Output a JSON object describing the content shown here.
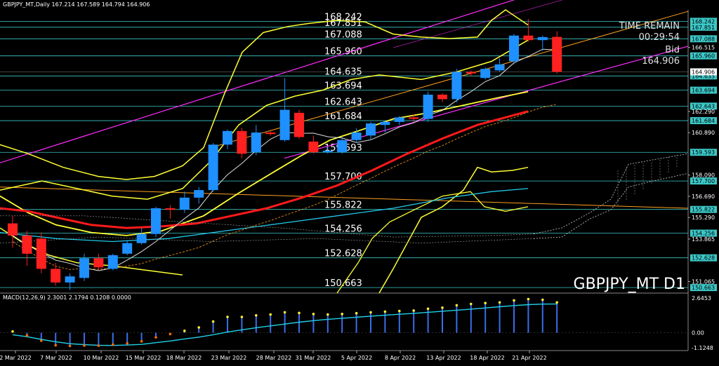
{
  "header": {
    "symbol_line": "GBPJPY_MT,Daily  167.214 167.589 164.794 164.906",
    "macd_line": "MACD(12,26,9) 2.3001 2.1794 0.1208 0.0000"
  },
  "info": {
    "time_remain_label": "TIME REMAIN",
    "time_remain_value": "00:29:54",
    "bid_label": "Bid",
    "bid_value": "164.906",
    "symbol_watermark": "GBPJPY_MT D1"
  },
  "colors": {
    "background": "#000000",
    "bull_candle": "#1e90ff",
    "bear_candle": "#ff2020",
    "level_line": "#3cc8c8",
    "magenta_channel": "#ff2cff",
    "yellow_band": "#ffff33",
    "red_ma": "#ff1a1a",
    "cyan_ma": "#20c8e8",
    "orange_trend": "#ffa020",
    "current_price": "#ff2020"
  },
  "levels": [
    {
      "value": 168.242,
      "label": "168.242"
    },
    {
      "value": 167.851,
      "label": "167.851"
    },
    {
      "value": 167.088,
      "label": "167.088"
    },
    {
      "value": 165.96,
      "label": "165.960"
    },
    {
      "value": 164.635,
      "label": "164.635"
    },
    {
      "value": 163.694,
      "label": "163.694"
    },
    {
      "value": 162.643,
      "label": "162.643"
    },
    {
      "value": 161.684,
      "label": "161.684"
    },
    {
      "value": 159.593,
      "label": "159.593"
    },
    {
      "value": 157.7,
      "label": "157.700"
    },
    {
      "value": 155.822,
      "label": "155.822"
    },
    {
      "value": 154.256,
      "label": "154.256"
    },
    {
      "value": 152.628,
      "label": "152.628"
    },
    {
      "value": 150.663,
      "label": "150.663"
    }
  ],
  "price_axis_ticks": [
    {
      "value": 166.515,
      "label": "166.515"
    },
    {
      "value": 162.29,
      "label": "162.290"
    },
    {
      "value": 160.89,
      "label": "160.890"
    },
    {
      "value": 158.09,
      "label": "158.090"
    },
    {
      "value": 156.69,
      "label": "156.690"
    },
    {
      "value": 155.29,
      "label": "155.290"
    },
    {
      "value": 153.865,
      "label": "153.865"
    },
    {
      "value": 151.065,
      "label": "151.065"
    }
  ],
  "macd_axis_ticks": [
    {
      "value": 2.6453,
      "label": "2.6453"
    },
    {
      "value": 0.0,
      "label": "0.00"
    },
    {
      "value": -1.1248,
      "label": "-1.1248"
    }
  ],
  "dates": [
    "2 Mar 2022",
    "7 Mar 2022",
    "10 Mar 2022",
    "15 Mar 2022",
    "18 Mar 2022",
    "23 Mar 2022",
    "28 Mar 2022",
    "31 Mar 2022",
    "5 Apr 2022",
    "8 Apr 2022",
    "13 Apr 2022",
    "18 Apr 2022",
    "21 Apr 2022"
  ],
  "chart_data": {
    "type": "candlestick",
    "title": "GBPJPY_MT D1",
    "ylim": [
      150.3,
      169.0
    ],
    "macd_ylim": [
      -1.35,
      2.9
    ],
    "candles": [
      {
        "date": "1 Mar 2022",
        "o": 154.9,
        "h": 155.4,
        "l": 153.3,
        "c": 154.1
      },
      {
        "date": "2 Mar 2022",
        "o": 154.1,
        "h": 154.4,
        "l": 152.1,
        "c": 152.9
      },
      {
        "date": "3 Mar 2022",
        "o": 153.9,
        "h": 154.3,
        "l": 151.6,
        "c": 151.9
      },
      {
        "date": "4 Mar 2022",
        "o": 151.9,
        "h": 152.3,
        "l": 150.8,
        "c": 151.0
      },
      {
        "date": "7 Mar 2022",
        "o": 151.0,
        "h": 151.6,
        "l": 150.5,
        "c": 151.4
      },
      {
        "date": "8 Mar 2022",
        "o": 151.3,
        "h": 152.9,
        "l": 151.1,
        "c": 152.6
      },
      {
        "date": "9 Mar 2022",
        "o": 152.6,
        "h": 152.9,
        "l": 151.8,
        "c": 152.0
      },
      {
        "date": "10 Mar 2022",
        "o": 151.9,
        "h": 152.9,
        "l": 151.8,
        "c": 152.8
      },
      {
        "date": "11 Mar 2022",
        "o": 152.9,
        "h": 153.8,
        "l": 152.8,
        "c": 153.6
      },
      {
        "date": "14 Mar 2022",
        "o": 153.6,
        "h": 154.6,
        "l": 153.5,
        "c": 154.2
      },
      {
        "date": "15 Mar 2022",
        "o": 154.2,
        "h": 156.0,
        "l": 154.0,
        "c": 155.9
      },
      {
        "date": "16 Mar 2022",
        "o": 155.9,
        "h": 156.1,
        "l": 155.2,
        "c": 155.8
      },
      {
        "date": "17 Mar 2022",
        "o": 155.8,
        "h": 157.0,
        "l": 155.6,
        "c": 156.6
      },
      {
        "date": "18 Mar 2022",
        "o": 156.6,
        "h": 157.3,
        "l": 156.2,
        "c": 157.1
      },
      {
        "date": "21 Mar 2022",
        "o": 157.1,
        "h": 160.2,
        "l": 157.0,
        "c": 160.1
      },
      {
        "date": "22 Mar 2022",
        "o": 160.1,
        "h": 161.1,
        "l": 159.8,
        "c": 161.0
      },
      {
        "date": "23 Mar 2022",
        "o": 161.0,
        "h": 161.2,
        "l": 159.2,
        "c": 159.5
      },
      {
        "date": "24 Mar 2022",
        "o": 159.6,
        "h": 161.4,
        "l": 159.4,
        "c": 160.9
      },
      {
        "date": "25 Mar 2022",
        "o": 160.9,
        "h": 161.0,
        "l": 160.7,
        "c": 160.8
      },
      {
        "date": "28 Mar 2022",
        "o": 160.4,
        "h": 164.5,
        "l": 160.3,
        "c": 162.4
      },
      {
        "date": "29 Mar 2022",
        "o": 162.2,
        "h": 162.4,
        "l": 160.5,
        "c": 160.6
      },
      {
        "date": "30 Mar 2022",
        "o": 160.3,
        "h": 160.7,
        "l": 159.5,
        "c": 159.6
      },
      {
        "date": "31 Mar 2022",
        "o": 159.6,
        "h": 160.0,
        "l": 159.5,
        "c": 159.7
      },
      {
        "date": "1 Apr 2022",
        "o": 159.6,
        "h": 160.6,
        "l": 159.5,
        "c": 160.4
      },
      {
        "date": "4 Apr 2022",
        "o": 160.4,
        "h": 161.2,
        "l": 160.2,
        "c": 160.9
      },
      {
        "date": "5 Apr 2022",
        "o": 160.7,
        "h": 161.6,
        "l": 160.4,
        "c": 161.5
      },
      {
        "date": "6 Apr 2022",
        "o": 161.4,
        "h": 161.7,
        "l": 160.9,
        "c": 161.6
      },
      {
        "date": "7 Apr 2022",
        "o": 161.6,
        "h": 162.0,
        "l": 161.4,
        "c": 161.9
      },
      {
        "date": "8 Apr 2022",
        "o": 161.9,
        "h": 162.1,
        "l": 161.6,
        "c": 161.8
      },
      {
        "date": "11 Apr 2022",
        "o": 161.8,
        "h": 163.6,
        "l": 161.6,
        "c": 163.4
      },
      {
        "date": "12 Apr 2022",
        "o": 163.4,
        "h": 163.5,
        "l": 162.9,
        "c": 163.1
      },
      {
        "date": "13 Apr 2022",
        "o": 163.1,
        "h": 165.1,
        "l": 162.9,
        "c": 164.9
      },
      {
        "date": "14 Apr 2022",
        "o": 164.9,
        "h": 165.0,
        "l": 164.6,
        "c": 164.8
      },
      {
        "date": "15 Apr 2022",
        "o": 164.5,
        "h": 165.2,
        "l": 164.4,
        "c": 165.1
      },
      {
        "date": "18 Apr 2022",
        "o": 165.0,
        "h": 165.8,
        "l": 164.9,
        "c": 165.4
      },
      {
        "date": "19 Apr 2022",
        "o": 165.6,
        "h": 167.4,
        "l": 165.4,
        "c": 167.3
      },
      {
        "date": "20 Apr 2022",
        "o": 167.3,
        "h": 168.4,
        "l": 166.9,
        "c": 167.0
      },
      {
        "date": "21 Apr 2022",
        "o": 167.0,
        "h": 167.3,
        "l": 166.3,
        "c": 167.2
      },
      {
        "date": "22 Apr 2022",
        "o": 167.214,
        "h": 167.589,
        "l": 164.794,
        "c": 164.906
      }
    ],
    "macd_signal": [
      -0.15,
      -0.3,
      -0.5,
      -0.68,
      -0.83,
      -0.9,
      -0.95,
      -0.96,
      -0.93,
      -0.88,
      -0.75,
      -0.62,
      -0.47,
      -0.33,
      -0.15,
      0.05,
      0.22,
      0.38,
      0.52,
      0.66,
      0.8,
      0.92,
      1.02,
      1.1,
      1.18,
      1.26,
      1.33,
      1.4,
      1.47,
      1.55,
      1.63,
      1.71,
      1.79,
      1.88,
      1.97,
      2.06,
      2.13,
      2.17,
      2.18
    ],
    "macd_main": [
      0.1,
      -0.2,
      -0.6,
      -0.95,
      -1.0,
      -0.97,
      -0.98,
      -0.9,
      -0.8,
      -0.65,
      -0.35,
      -0.1,
      0.15,
      0.4,
      0.85,
      1.2,
      1.2,
      1.32,
      1.38,
      1.55,
      1.5,
      1.42,
      1.38,
      1.42,
      1.48,
      1.55,
      1.6,
      1.65,
      1.68,
      1.82,
      1.9,
      2.08,
      2.18,
      2.25,
      2.3,
      2.45,
      2.55,
      2.5,
      2.3
    ]
  }
}
